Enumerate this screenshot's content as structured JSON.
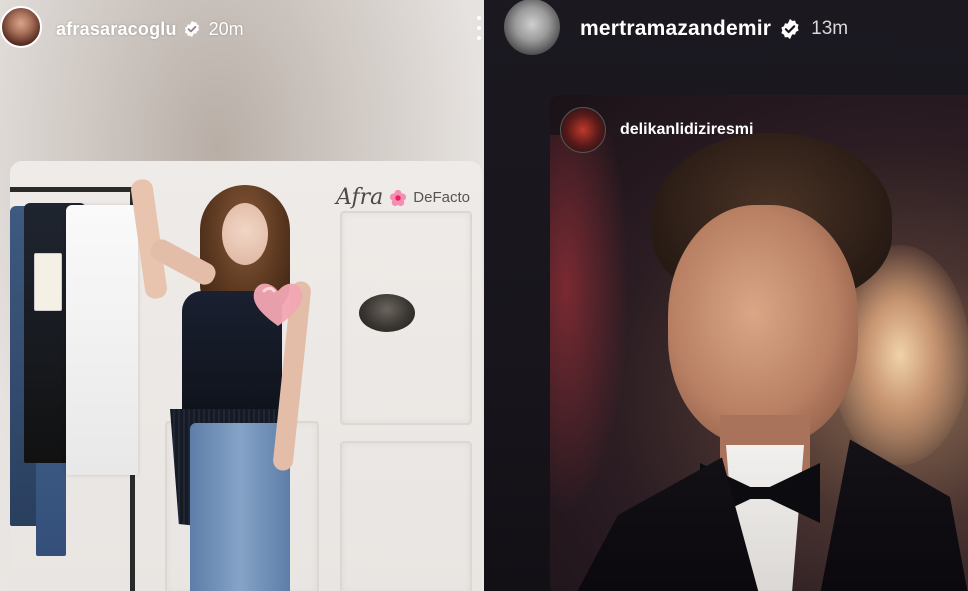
{
  "left_story": {
    "username": "afrasaracoglu",
    "time": "20m",
    "verified_icon": "verified-badge-icon",
    "more_icon": "more-vertical-icon",
    "post": {
      "brand_script": "Afra",
      "brand_name": "DeFacto",
      "sticker": "heart-sticker-icon"
    }
  },
  "right_story": {
    "username": "mertramazandemir",
    "time": "13m",
    "verified_icon": "verified-badge-icon",
    "reposted_post": {
      "username": "delikanlidiziresmi"
    }
  },
  "colors": {
    "text": "#ffffff",
    "verified_fill": "#ffffff",
    "heart": "#f2a7b2",
    "dark_bg": "#18151c"
  }
}
